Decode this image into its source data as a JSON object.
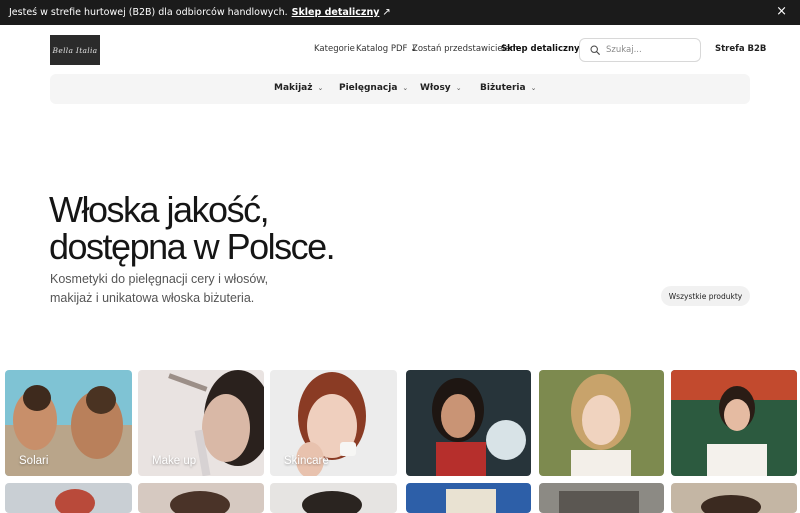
{
  "topbar": {
    "message": "Jesteś w strefie hurtowej (B2B) dla odbiorców handlowych.",
    "link_label": "Sklep detaliczny",
    "link_arrow": "↗",
    "close": "×"
  },
  "header": {
    "logo_text": "Bella Italia",
    "nav": {
      "kategorie": "Kategorie",
      "katalog": "Katalog PDF ↓",
      "przedstawiciel": "Zostań przedstawicielem",
      "sklep": "Sklep detaliczny ↗",
      "strefa": "Strefa B2B"
    },
    "search_placeholder": "Szukaj..."
  },
  "categories": {
    "makijaz": "Makijaż",
    "pielegnacja": "Pielęgnacja",
    "wlosy": "Włosy",
    "bizuteria": "Biżuteria",
    "chevron": "⌄"
  },
  "hero": {
    "title_line1": "Włoska jakość,",
    "title_line2": "dostępna w Polsce.",
    "subtitle_line1": "Kosmetyki do pielęgnacji cery i włosów,",
    "subtitle_line2": "makijaż i unikatowa włoska biżuteria.",
    "button": "Wszystkie produkty"
  },
  "tiles": {
    "solari": "Solari",
    "makeup": "Make up",
    "skincare": "Skincare"
  },
  "colors": {
    "topbar_bg": "#1b1b1b",
    "category_bar_bg": "#f5f5f5"
  }
}
